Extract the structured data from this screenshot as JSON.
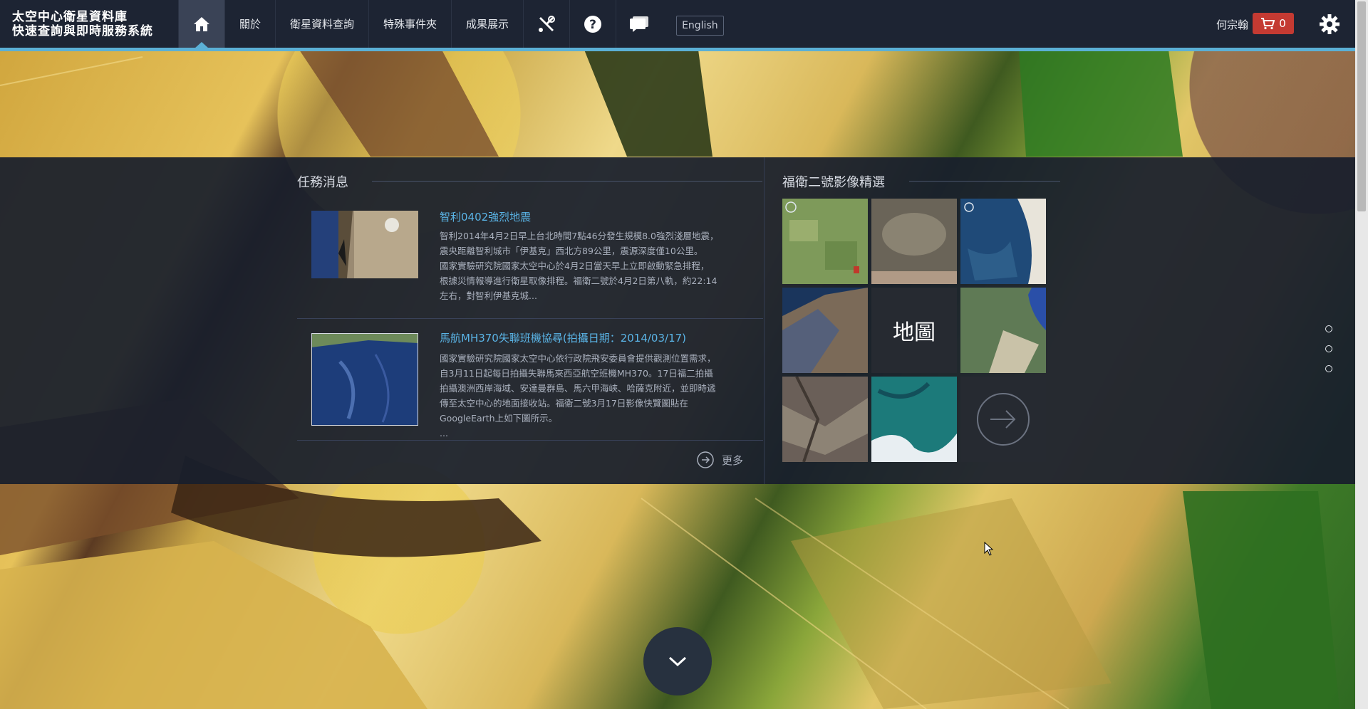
{
  "header": {
    "brand_line1": "太空中心衛星資料庫",
    "brand_line2": "快速查詢與即時服務系統",
    "nav": [
      "關於",
      "衛星資料查詢",
      "特殊事件夾",
      "成果展示"
    ],
    "lang_button": "English",
    "user_name": "何宗翰",
    "cart_count": "0",
    "icons": [
      "home-icon",
      "tools-icon",
      "help-icon",
      "chat-icon",
      "cart-icon",
      "gear-icon"
    ]
  },
  "news": {
    "heading": "任務消息",
    "items": [
      {
        "title": "智利0402強烈地震",
        "lines": [
          "智利2014年4月2日早上台北時間7點46分發生規模8.0強烈淺層地震，",
          "震央距離智利城市「伊基克」西北方89公里，震源深度僅10公里。",
          "國家實驗研究院國家太空中心於4月2日當天早上立即啟動緊急排程，",
          "根據災情報導進行衛星取像排程。福衛二號於4月2日第八軌，約22:14",
          "左右，對智利伊基克城..."
        ]
      },
      {
        "title": "馬航MH370失聯班機協尋(拍攝日期：2014/03/17)",
        "lines": [
          "國家實驗研究院國家太空中心依行政院飛安委員會提供觀測位置需求，",
          "自3月11日起每日拍攝失聯馬來西亞航空班機MH370。17日福二拍攝",
          "拍攝澳洲西岸海域、安達曼群島、馬六甲海峽、哈薩克附近，並即時遞",
          "傳至太空中心的地面接收站。福衛二號3月17日影像快覽圖貼在",
          "GoogleEarth上如下圖所示。",
          "..."
        ]
      }
    ],
    "more_label": "更多"
  },
  "gallery": {
    "heading": "福衛二號影像精選",
    "map_label": "地圖"
  },
  "colors": {
    "accent": "#5bb0d6",
    "link": "#5ab4e6",
    "cart": "#c43a32",
    "panel": "#181e2c"
  }
}
